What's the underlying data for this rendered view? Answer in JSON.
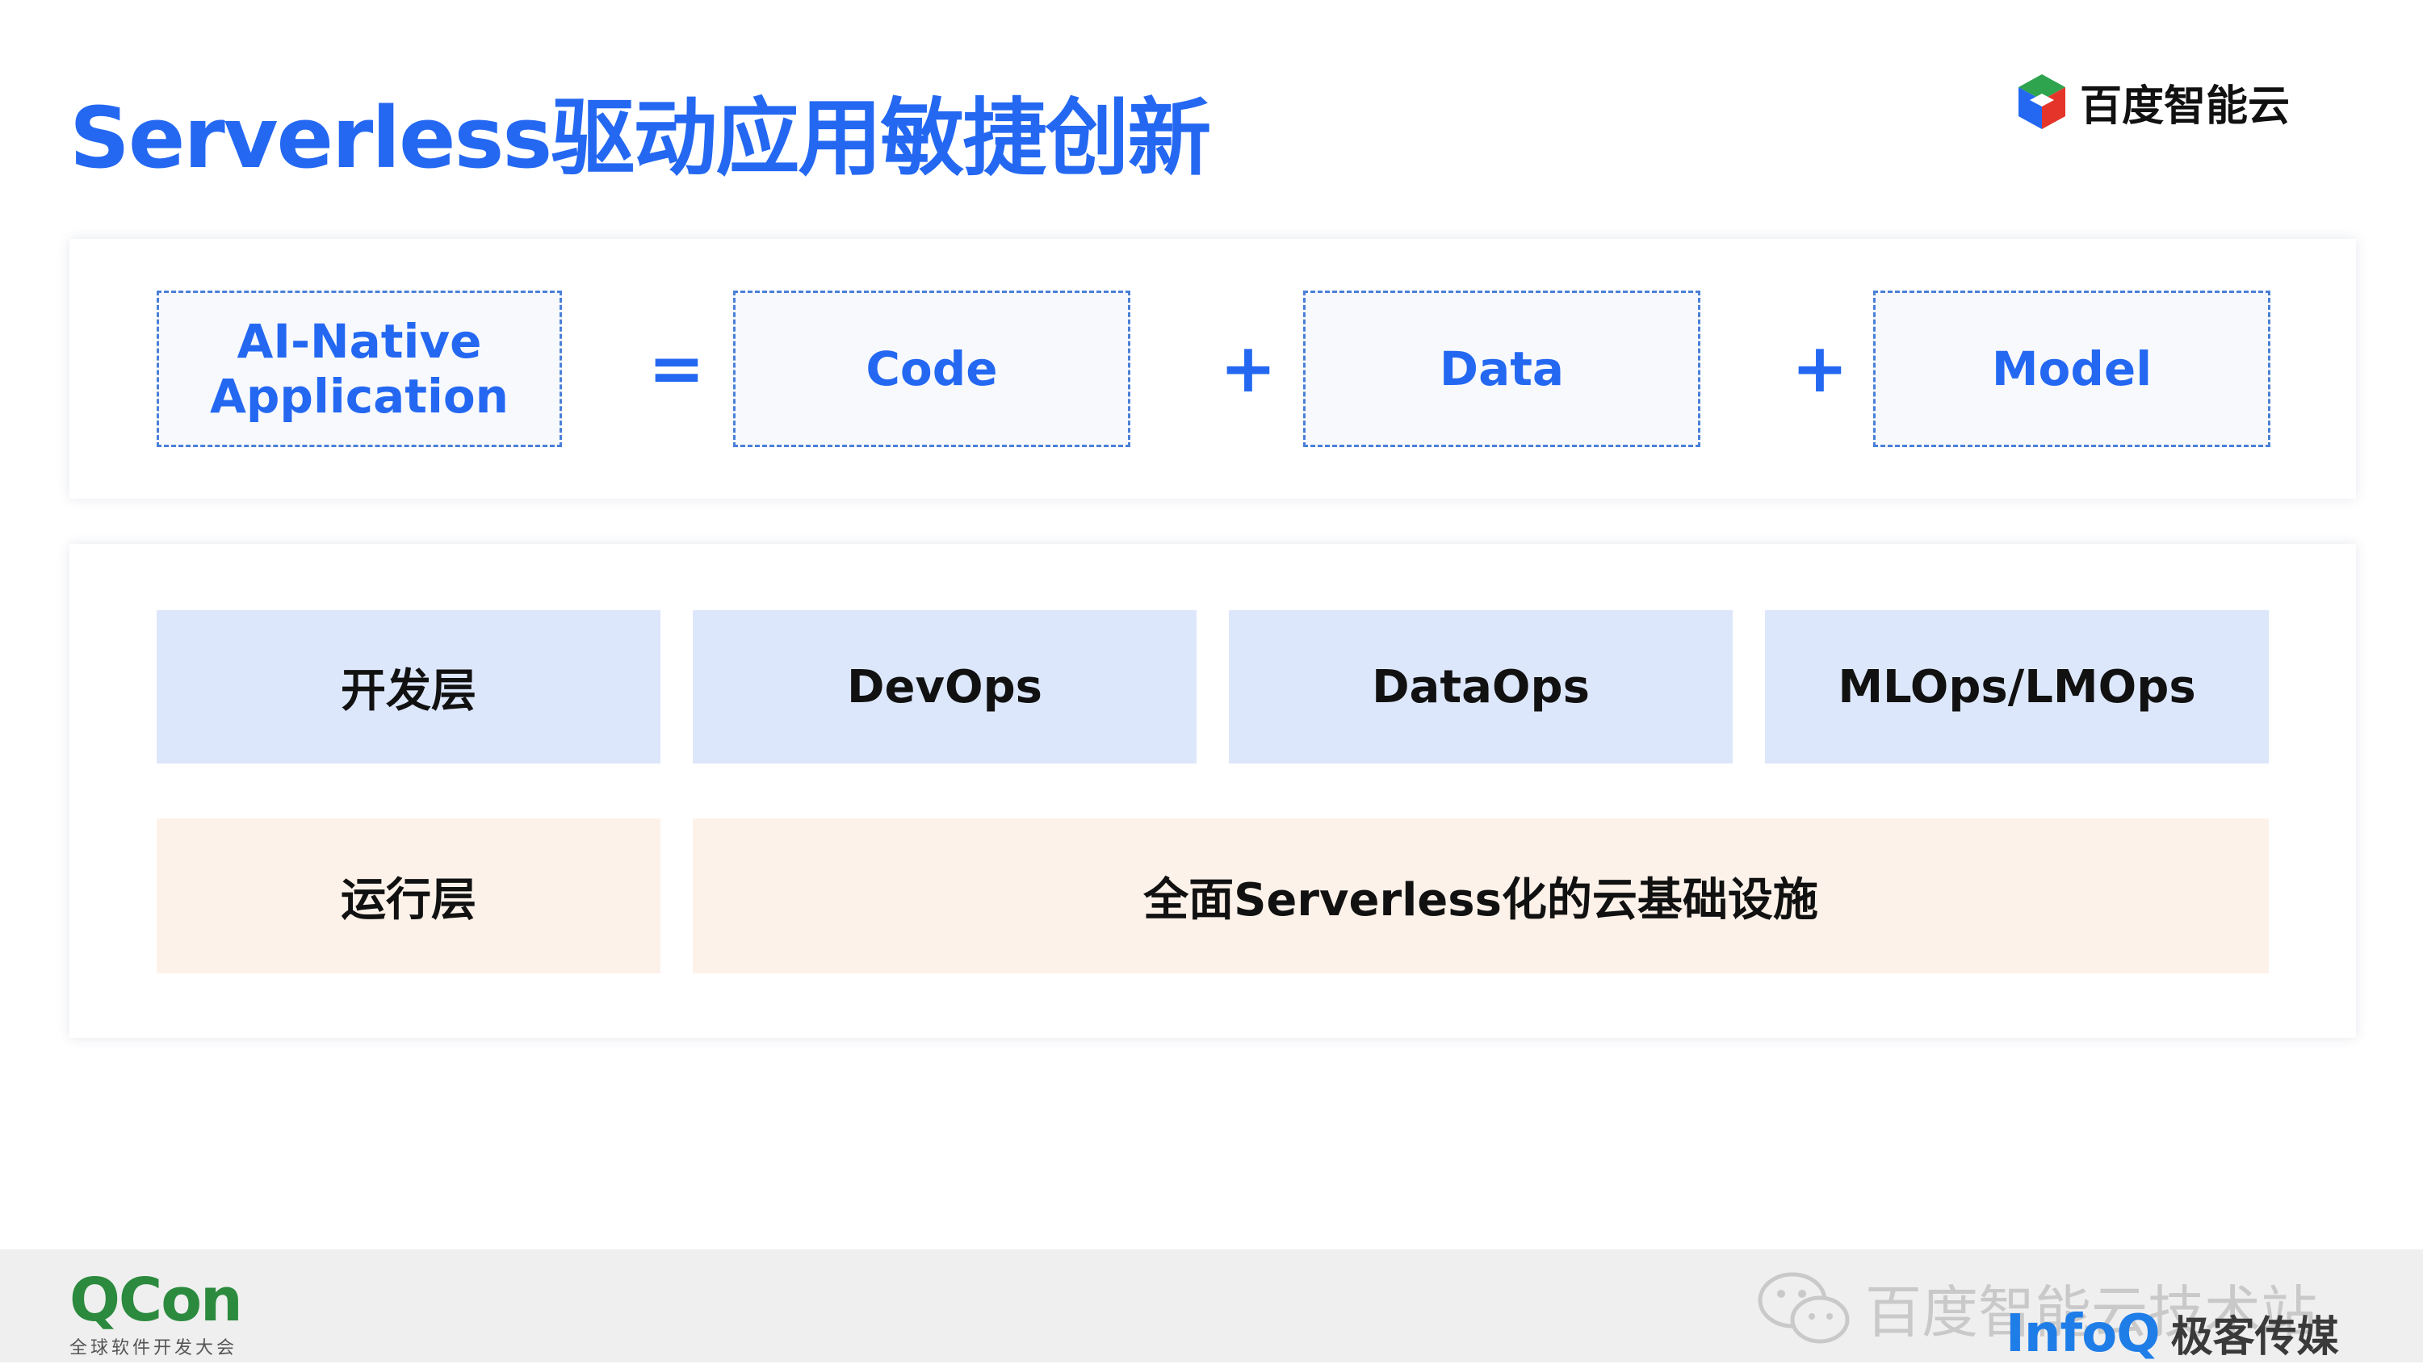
{
  "slide": {
    "title": "Serverless驱动应用敏捷创新",
    "brand": "百度智能云"
  },
  "equation": {
    "lhs_line1": "AI-Native",
    "lhs_line2": "Application",
    "equals": "=",
    "plus": "+",
    "terms": [
      "Code",
      "Data",
      "Model"
    ]
  },
  "layers": {
    "dev": {
      "label": "开发层",
      "items": [
        "DevOps",
        "DataOps",
        "MLOps/LMOps"
      ]
    },
    "runtime": {
      "label": "运行层",
      "content": "全面Serverless化的云基础设施"
    }
  },
  "footer": {
    "qcon_logo": "QCon",
    "qcon_sub": "全球软件开发大会",
    "watermark": "百度智能云技术站",
    "infoq_logo": "InfoQ",
    "infoq_text": "极客传媒"
  },
  "colors": {
    "accent_blue": "#2468f2",
    "dev_row_bg": "#dde7fb",
    "runtime_row_bg": "#fdf2ea"
  }
}
